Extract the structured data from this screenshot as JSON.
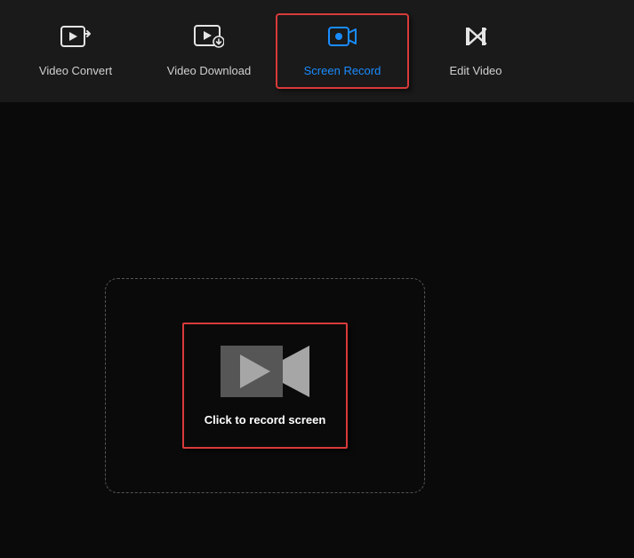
{
  "toolbar": {
    "tabs": [
      {
        "label": "Video Convert",
        "icon": "video-convert-icon"
      },
      {
        "label": "Video Download",
        "icon": "video-download-icon"
      },
      {
        "label": "Screen Record",
        "icon": "screen-record-icon",
        "active": true
      },
      {
        "label": "Edit Video",
        "icon": "edit-video-icon"
      }
    ]
  },
  "main": {
    "record_button_label": "Click to record screen"
  }
}
